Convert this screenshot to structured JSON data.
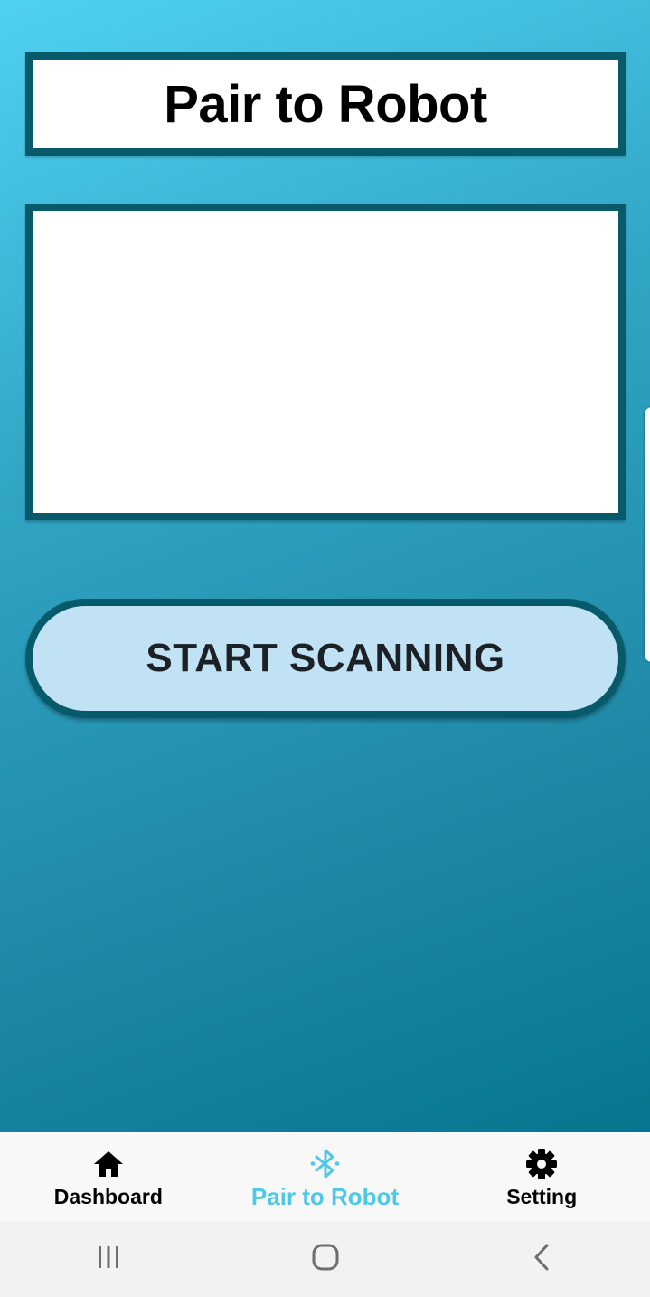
{
  "header": {
    "title": "Pair to Robot"
  },
  "device_list": {
    "items": []
  },
  "scan_button": {
    "label": "START SCANNING"
  },
  "bottom_nav": {
    "items": [
      {
        "label": "Dashboard",
        "icon": "home-icon",
        "active": false
      },
      {
        "label": "Pair to Robot",
        "icon": "bluetooth-searching-icon",
        "active": true
      },
      {
        "label": "Setting",
        "icon": "gear-icon",
        "active": false
      }
    ]
  },
  "system_nav": {
    "items": [
      {
        "icon": "recent-apps-icon"
      },
      {
        "icon": "home-circle-icon"
      },
      {
        "icon": "back-chevron-icon"
      }
    ]
  },
  "colors": {
    "gradient_top": "#4fd1f3",
    "gradient_bottom": "#06768f",
    "border_dark": "#075a6a",
    "button_fill": "#c1e2f4",
    "active_tab": "#4dc8e6",
    "nav_bg": "#f8f8f8"
  }
}
